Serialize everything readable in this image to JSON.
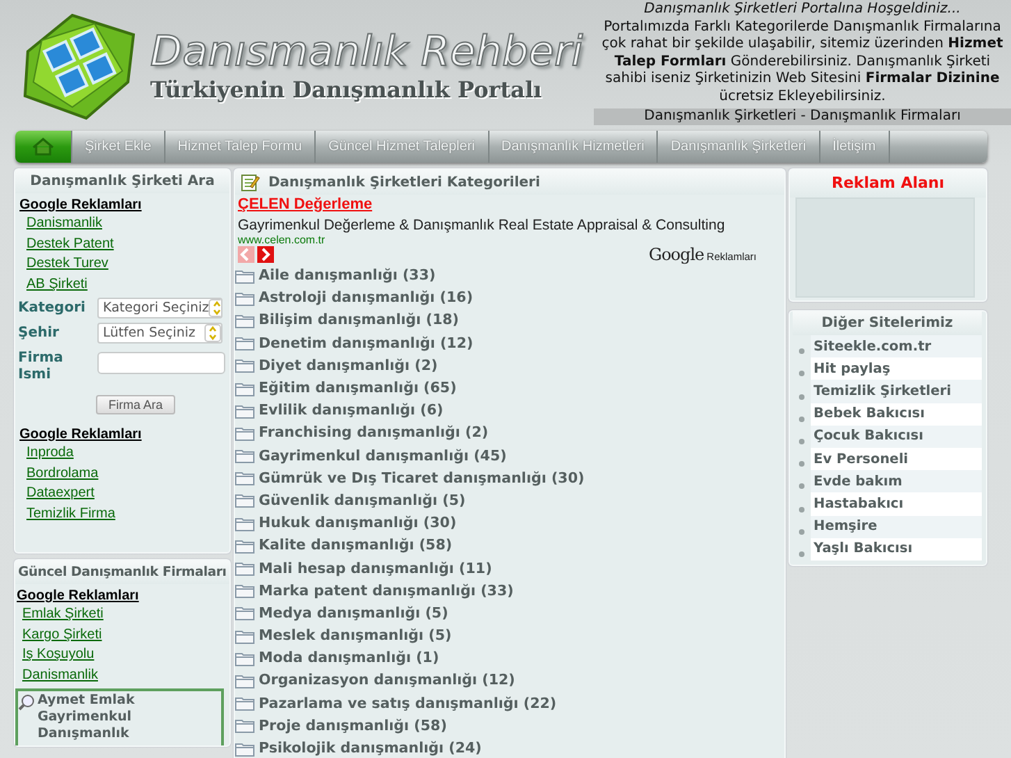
{
  "header": {
    "logo_title": "Danısmanlık Rehberi",
    "logo_subtitle": "Türkiyenin Danışmanlık Portalı",
    "welcome": "Danışmanlık Şirketleri Portalına Hoşgeldiniz...",
    "intro": "Portalımızda Farklı Kategorilerde Danışmanlık Firmalarına çok rahat bir şekilde ulaşabilir, sitemiz üzerinden **Hizmet Talep Formları** Gönderebilirsiniz. Danışmanlık Şirketi sahibi iseniz Şirketinizin Web Sitesini **Firmalar Dizinine** ücretsiz Ekleyebilirsiniz.",
    "tagline": "Danışmanlık Şirketleri - Danışmanlık Firmaları"
  },
  "nav": [
    {
      "kind": "home",
      "selected": true
    },
    {
      "kind": "link",
      "label": "Şirket Ekle",
      "selected": false
    },
    {
      "kind": "link",
      "label": "Hizmet Talep Formu",
      "selected": false
    },
    {
      "kind": "link",
      "label": "Güncel Hizmet Talepleri",
      "selected": false
    },
    {
      "kind": "link",
      "label": "Danışmanlık Hizmetleri",
      "selected": false
    },
    {
      "kind": "link",
      "label": "Danışmanlık Şirketleri",
      "selected": false
    },
    {
      "kind": "link",
      "label": "İletişim",
      "selected": false
    }
  ],
  "search_panel": {
    "title": "Danışmanlık Şirketi Ara",
    "ads_heading": "Google Reklamları",
    "ads": [
      "Danismanlik",
      "Destek Patent",
      "Destek Turev",
      "AB Şirketi"
    ],
    "fields": [
      {
        "kind": "select",
        "label": "Kategori",
        "value": "Kategori Seçiniz"
      },
      {
        "kind": "select",
        "label": "Şehir",
        "value": "Lütfen Seçiniz"
      },
      {
        "kind": "text",
        "label": "Firma Ismi"
      }
    ],
    "button": "Firma Ara",
    "ads_heading_2": "Google Reklamları",
    "ads_2": [
      "Inproda",
      "Bordrolama",
      "Dataexpert",
      "Temizlik Firma"
    ]
  },
  "recent_panel": {
    "title": "Güncel Danışmanlık Firmaları",
    "ads_heading": "Google Reklamları",
    "ads": [
      "Emlak Şirketi",
      "Kargo Şirketi",
      "Iş Koşuyolu",
      "Danismanlik"
    ],
    "firm": "Aymet Emlak Gayrimenkul Danışmanlık"
  },
  "categories_panel": {
    "title": "Danışmanlık Şirketleri Kategorileri",
    "ad": {
      "title": "ÇELEN Değerleme",
      "text": "Gayrimenkul Değerleme & Danışmanlık Real Estate Appraisal & Consulting",
      "url": "www.celen.com.tr",
      "prev_disabled": true,
      "next_disabled": false,
      "brand": "Google",
      "brand_label": "Reklamları"
    },
    "items": [
      "Aile danışmanlığı (33)",
      "Astroloji danışmanlığı (16)",
      "Bilişim danışmanlığı (18)",
      "Denetim danışmanlığı (12)",
      "Diyet danışmanlığı (2)",
      "Eğitim danışmanlığı (65)",
      "Evlilik danışmanlığı (6)",
      "Franchising danışmanlığı (2)",
      "Gayrimenkul danışmanlığı (45)",
      "Gümrük ve Dış Ticaret danışmanlığı (30)",
      "Güvenlik danışmanlığı (5)",
      "Hukuk danışmanlığı (30)",
      "Kalite danışmanlığı (58)",
      "Mali hesap danışmanlığı (11)",
      "Marka patent danışmanlığı (33)",
      "Medya danışmanlığı (5)",
      "Meslek danışmanlığı (5)",
      "Moda danışmanlığı (1)",
      "Organizasyon danışmanlığı (12)",
      "Pazarlama ve satış danışmanlığı (22)",
      "Proje danışmanlığı (58)",
      "Psikolojik danışmanlığı (24)"
    ]
  },
  "ad_panel": {
    "title": "Reklam Alanı"
  },
  "sites_panel": {
    "title": "Diğer Sitelerimiz",
    "items": [
      "Siteekle.com.tr",
      "Hit paylaş",
      "Temizlik Şirketleri",
      "Bebek Bakıcısı",
      "Çocuk Bakıcısı",
      "Ev Personeli",
      "Evde bakım",
      "Hastabakıcı",
      "Hemşire",
      "Yaşlı Bakıcısı"
    ]
  }
}
